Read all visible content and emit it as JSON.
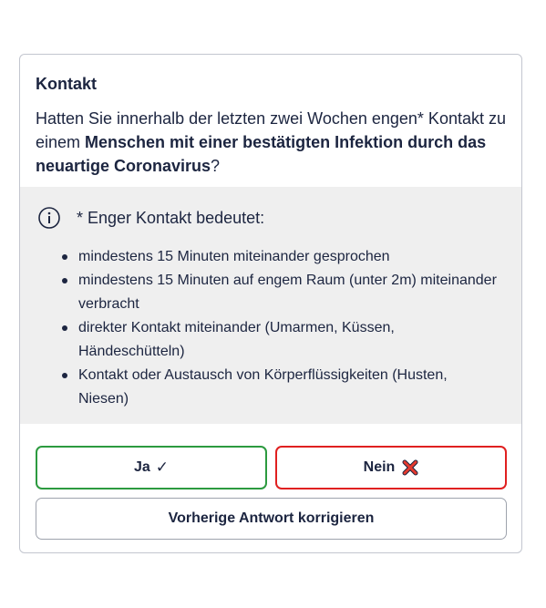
{
  "card": {
    "heading": "Kontakt",
    "question_part1": "Hatten Sie innerhalb der letzten zwei Wochen engen* Kontakt zu einem ",
    "question_bold": "Menschen mit einer bestätigten Infektion durch das neuartige Coronavirus",
    "question_end": "?"
  },
  "info": {
    "icon": "info-icon",
    "title": "* Enger Kontakt bedeutet:",
    "bullets": [
      "mindestens 15 Minuten miteinander gesprochen",
      "mindestens 15 Minuten auf engem Raum (unter 2m) miteinander verbracht",
      "direkter Kontakt miteinander (Umarmen, Küssen, Händeschütteln)",
      "Kontakt oder Austausch von Körperflüssigkeiten (Husten, Niesen)"
    ]
  },
  "buttons": {
    "yes_label": "Ja",
    "yes_icon_glyph": "✓",
    "no_label": "Nein",
    "no_icon": "cross-icon",
    "correct_label": "Vorherige Antwort korrigieren"
  },
  "colors": {
    "yes_border": "#2c9a3f",
    "no_border": "#e02020",
    "text": "#1c2540",
    "info_bg": "#efefef"
  }
}
